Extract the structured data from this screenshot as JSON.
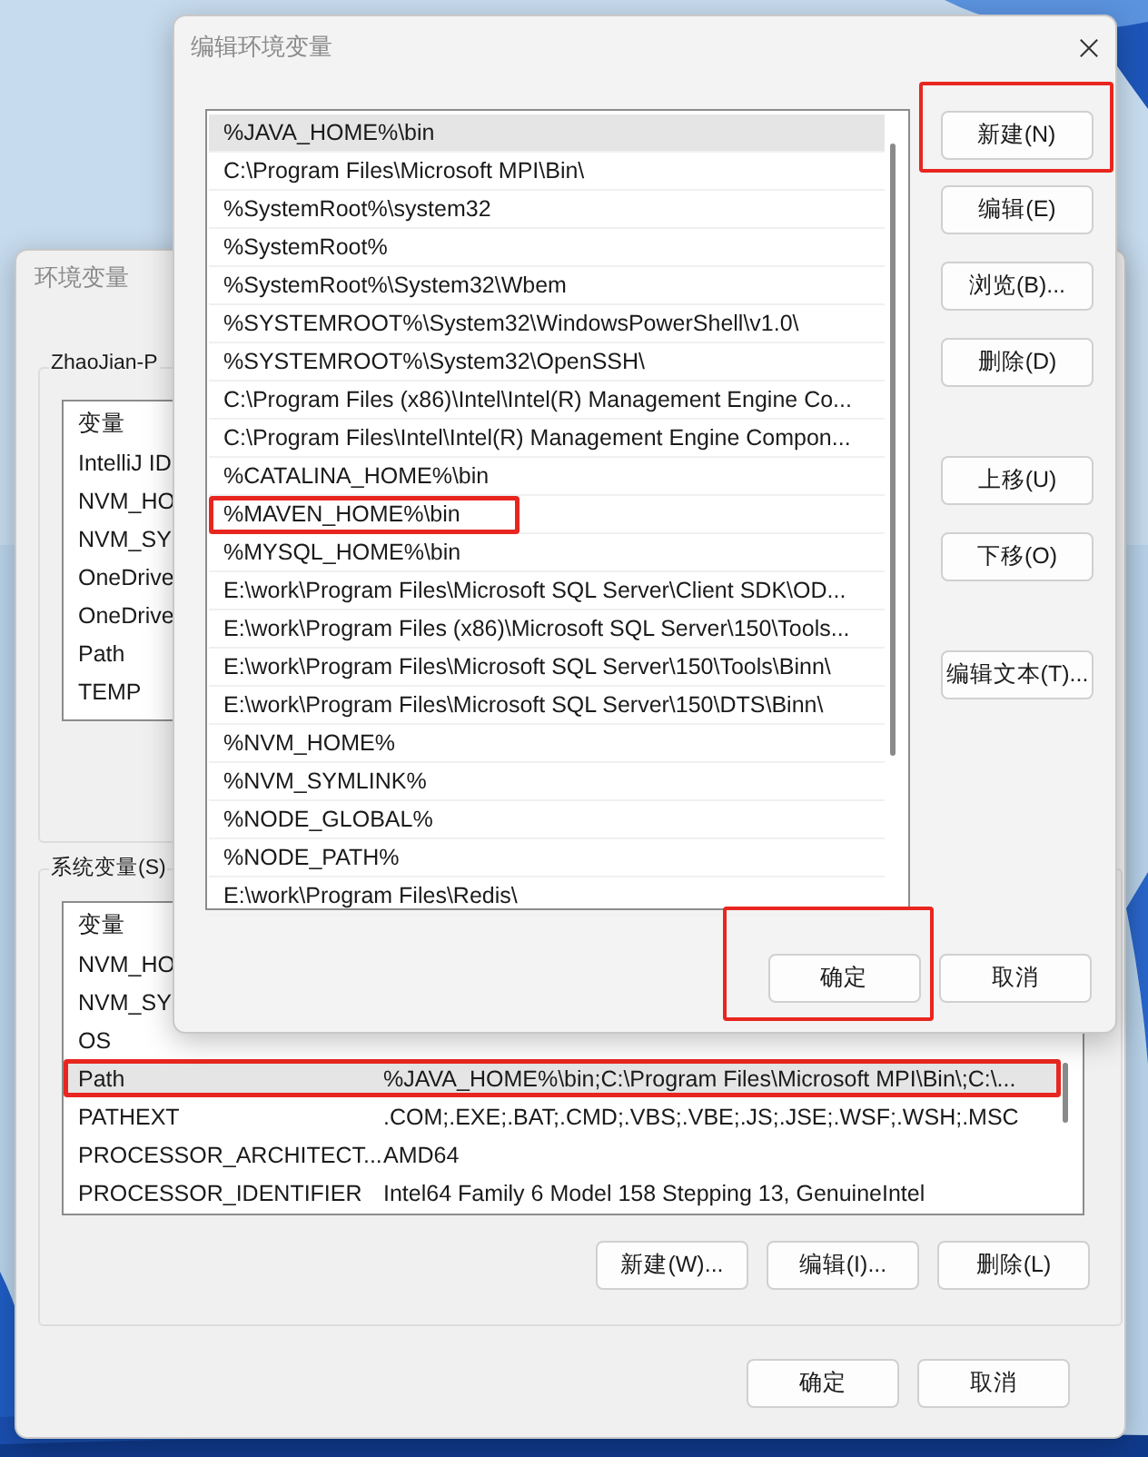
{
  "back_window": {
    "title": "环境变量",
    "user_group": {
      "title": "ZhaoJian-P",
      "header": "变量",
      "rows": [
        {
          "name": "IntelliJ ID"
        },
        {
          "name": "NVM_HO"
        },
        {
          "name": "NVM_SY"
        },
        {
          "name": "OneDrive"
        },
        {
          "name": "OneDrive"
        },
        {
          "name": "Path"
        },
        {
          "name": "TEMP"
        }
      ]
    },
    "system_group": {
      "title": "系统变量(S)",
      "header": "变量",
      "rows": [
        {
          "name": "NVM_HO",
          "selected": false,
          "highlighted": false
        },
        {
          "name": "NVM_SY",
          "selected": false,
          "highlighted": false
        },
        {
          "name": "OS",
          "selected": false,
          "highlighted": false
        },
        {
          "name": "Path",
          "value": "%JAVA_HOME%\\bin;C:\\Program Files\\Microsoft MPI\\Bin\\;C:\\...",
          "selected": true,
          "highlighted": true
        },
        {
          "name": "PATHEXT",
          "value": ".COM;.EXE;.BAT;.CMD;.VBS;.VBE;.JS;.JSE;.WSF;.WSH;.MSC",
          "selected": false,
          "highlighted": false
        },
        {
          "name": "PROCESSOR_ARCHITECT...",
          "value": "AMD64",
          "selected": false,
          "highlighted": false
        },
        {
          "name": "PROCESSOR_IDENTIFIER",
          "value": "Intel64 Family 6 Model 158 Stepping 13, GenuineIntel",
          "selected": false,
          "highlighted": false
        }
      ]
    },
    "group_buttons": [
      "新建(W)...",
      "编辑(I)...",
      "删除(L)"
    ],
    "buttons": [
      "确定",
      "取消"
    ]
  },
  "edit_dialog": {
    "title": "编辑环境变量",
    "entries": [
      {
        "text": "%JAVA_HOME%\\bin",
        "selected": true,
        "highlighted": false
      },
      {
        "text": "C:\\Program Files\\Microsoft MPI\\Bin\\",
        "selected": false,
        "highlighted": false
      },
      {
        "text": "%SystemRoot%\\system32",
        "selected": false,
        "highlighted": false
      },
      {
        "text": "%SystemRoot%",
        "selected": false,
        "highlighted": false
      },
      {
        "text": "%SystemRoot%\\System32\\Wbem",
        "selected": false,
        "highlighted": false
      },
      {
        "text": "%SYSTEMROOT%\\System32\\WindowsPowerShell\\v1.0\\",
        "selected": false,
        "highlighted": false
      },
      {
        "text": "%SYSTEMROOT%\\System32\\OpenSSH\\",
        "selected": false,
        "highlighted": false
      },
      {
        "text": "C:\\Program Files (x86)\\Intel\\Intel(R) Management Engine Co...",
        "selected": false,
        "highlighted": false
      },
      {
        "text": "C:\\Program Files\\Intel\\Intel(R) Management Engine Compon...",
        "selected": false,
        "highlighted": false
      },
      {
        "text": "%CATALINA_HOME%\\bin",
        "selected": false,
        "highlighted": false
      },
      {
        "text": "%MAVEN_HOME%\\bin",
        "selected": false,
        "highlighted": true
      },
      {
        "text": "%MYSQL_HOME%\\bin",
        "selected": false,
        "highlighted": false
      },
      {
        "text": "E:\\work\\Program Files\\Microsoft SQL Server\\Client SDK\\OD...",
        "selected": false,
        "highlighted": false
      },
      {
        "text": "E:\\work\\Program Files (x86)\\Microsoft SQL Server\\150\\Tools...",
        "selected": false,
        "highlighted": false
      },
      {
        "text": "E:\\work\\Program Files\\Microsoft SQL Server\\150\\Tools\\Binn\\",
        "selected": false,
        "highlighted": false
      },
      {
        "text": "E:\\work\\Program Files\\Microsoft SQL Server\\150\\DTS\\Binn\\",
        "selected": false,
        "highlighted": false
      },
      {
        "text": "%NVM_HOME%",
        "selected": false,
        "highlighted": false
      },
      {
        "text": "%NVM_SYMLINK%",
        "selected": false,
        "highlighted": false
      },
      {
        "text": "%NODE_GLOBAL%",
        "selected": false,
        "highlighted": false
      },
      {
        "text": "%NODE_PATH%",
        "selected": false,
        "highlighted": false
      },
      {
        "text": "E:\\work\\Program Files\\Redis\\",
        "selected": false,
        "highlighted": false
      }
    ],
    "side_button_groups": [
      [
        {
          "label": "新建(N)",
          "highlighted": true
        },
        {
          "label": "编辑(E)",
          "highlighted": false
        },
        {
          "label": "浏览(B)...",
          "highlighted": false
        },
        {
          "label": "删除(D)",
          "highlighted": false
        }
      ],
      [
        {
          "label": "上移(U)",
          "highlighted": false
        },
        {
          "label": "下移(O)",
          "highlighted": false
        }
      ],
      [
        {
          "label": "编辑文本(T)...",
          "highlighted": false
        }
      ]
    ],
    "buttons": [
      {
        "label": "确定",
        "highlighted": true
      },
      {
        "label": "取消",
        "highlighted": false
      }
    ]
  }
}
